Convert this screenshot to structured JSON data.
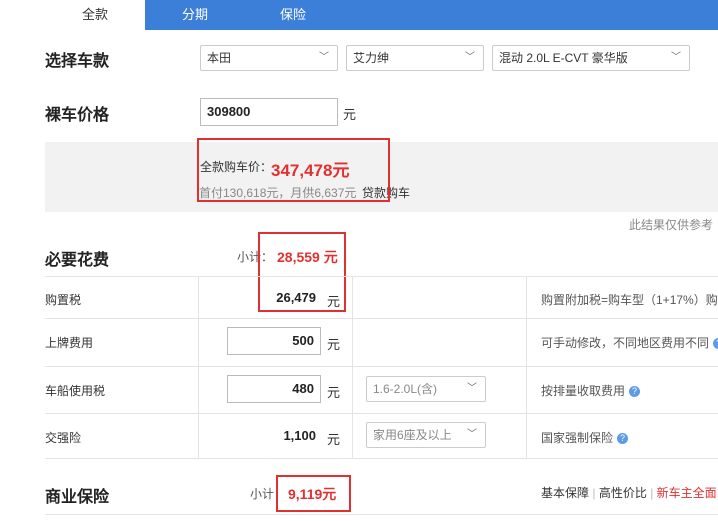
{
  "tabs": [
    {
      "label": "全款"
    },
    {
      "label": "分期"
    },
    {
      "label": "保险"
    }
  ],
  "select_model": {
    "title": "选择车款",
    "brand": "本田",
    "series": "艾力绅",
    "trim": "混动 2.0L E-CVT 豪华版"
  },
  "price": {
    "title": "裸车价格",
    "value": "309800",
    "unit": "元"
  },
  "summary": {
    "full_label": "全款购车价：",
    "full_value": "347,478元",
    "loan_text": "首付130,618元，月供6,637元",
    "loan_link": "贷款购车",
    "disclaimer": "此结果仅供参考"
  },
  "required": {
    "title": "必要花费",
    "subtotal_label": "小计：",
    "subtotal_value": "28,559 元",
    "rows": [
      {
        "label": "购置税",
        "value": "26,479",
        "unit": "元",
        "note": "购置附加税=购车型（1+17%）购"
      },
      {
        "label": "上牌费用",
        "value": "500",
        "unit": "元",
        "note": "可手动修改，不同地区费用不同"
      },
      {
        "label": "车船使用税",
        "value": "480",
        "unit": "元",
        "option": "1.6-2.0L(含)",
        "note": "按排量收取费用"
      },
      {
        "label": "交强险",
        "value": "1,100",
        "unit": "元",
        "option": "家用6座及以上",
        "note": "国家强制保险"
      }
    ]
  },
  "commercial": {
    "title": "商业保险",
    "subtotal_label": "小计：",
    "subtotal_value": "9,119元",
    "options": [
      "基本保障",
      "高性价比",
      "新车主全面"
    ]
  },
  "colors": {
    "accent_blue": "#3c7fd9",
    "price_red": "#e13030",
    "highlight_box": "#e13030"
  }
}
